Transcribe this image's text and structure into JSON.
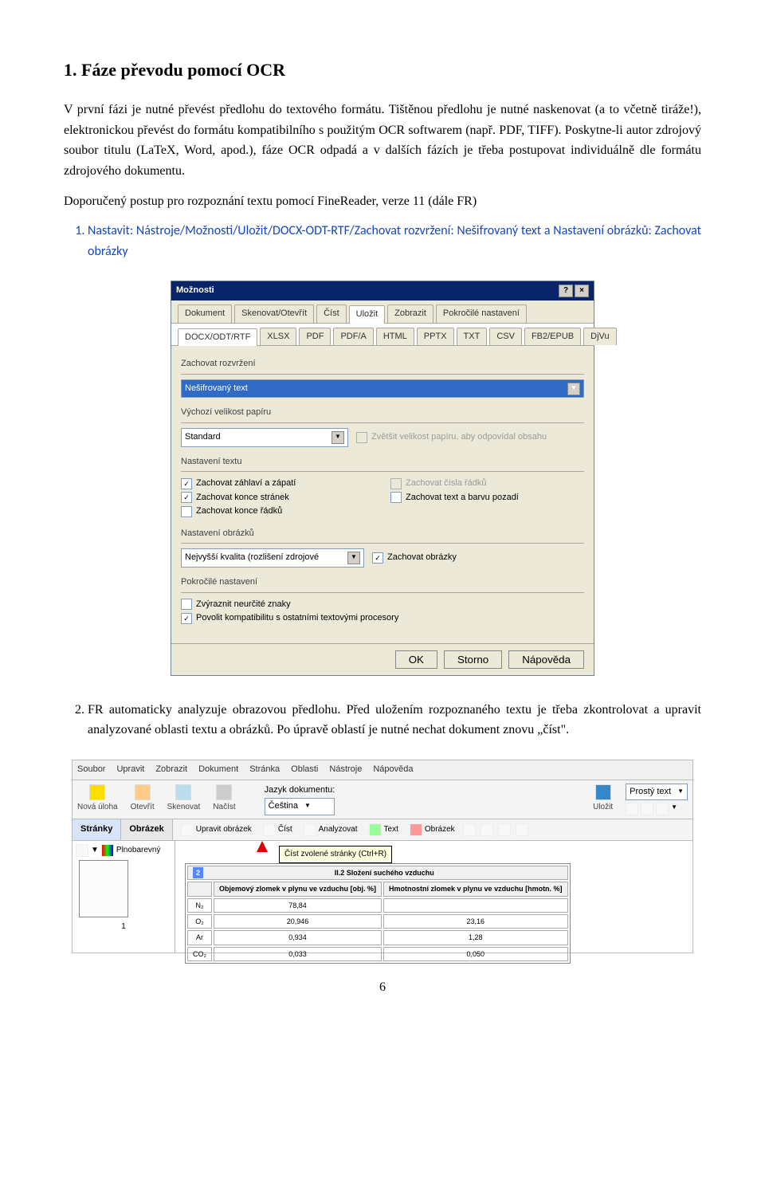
{
  "heading": "1. Fáze převodu pomocí OCR",
  "p1": "V první fázi je nutné převést předlohu do textového formátu. Tištěnou předlohu je nutné naskenovat (a to včetně tiráže!), elektronickou převést do formátu kompatibilního s použitým OCR softwarem (např. PDF, TIFF). Poskytne-li autor zdrojový soubor titulu (LaTeX, Word, apod.), fáze OCR odpadá a v dalších fázích je třeba postupovat individuálně dle formátu zdrojového dokumentu.",
  "p2": "Doporučený postup pro rozpoznání textu pomocí FineReader, verze 11 (dále FR)",
  "li1": "Nastavit: Nástroje/Možnosti/Uložit/DOCX-ODT-RTF/Zachovat rozvržení: Nešifrovaný text a Nastavení obrázků: Zachovat obrázky",
  "li2": "FR automaticky analyzuje obrazovou předlohu. Před uložením rozpoznaného textu je třeba zkontrolovat a upravit analyzované oblasti textu a obrázků. Po úpravě oblastí je nutné nechat dokument znovu „číst\".",
  "dlg": {
    "title": "Možnosti",
    "tabs": [
      "Dokument",
      "Skenovat/Otevřít",
      "Číst",
      "Uložit",
      "Zobrazit",
      "Pokročilé nastavení"
    ],
    "active_tab": 3,
    "fmt_tabs": [
      "DOCX/ODT/RTF",
      "XLSX",
      "PDF",
      "PDF/A",
      "HTML",
      "PPTX",
      "TXT",
      "CSV",
      "FB2/EPUB",
      "DjVu"
    ],
    "g_layout": "Zachovat rozvržení",
    "layout_val": "Nešifrovaný text",
    "g_paper": "Výchozí velikost papíru",
    "paper_val": "Standard",
    "chk_enlarge": "Zvětšit velikost papíru, aby odpovídal obsahu",
    "g_text": "Nastavení textu",
    "chk_header": "Zachovat záhlaví a zápatí",
    "chk_linenum": "Zachovat čísla řádků",
    "chk_pagebreak": "Zachovat konce stránek",
    "chk_bgtext": "Zachovat text a barvu pozadí",
    "chk_linebreak": "Zachovat konce řádků",
    "g_img": "Nastavení obrázků",
    "img_val": "Nejvyšší kvalita (rozlišení zdrojové",
    "chk_keepimg": "Zachovat obrázky",
    "g_adv": "Pokročilé nastavení",
    "chk_hilite": "Zvýraznit neurčité znaky",
    "chk_compat": "Povolit kompatibilitu s ostatními textovými procesory",
    "btn_ok": "OK",
    "btn_cancel": "Storno",
    "btn_help": "Nápověda"
  },
  "tb": {
    "menus": [
      "Soubor",
      "Upravit",
      "Zobrazit",
      "Dokument",
      "Stránka",
      "Oblasti",
      "Nástroje",
      "Nápověda"
    ],
    "btn_new": "Nová úloha",
    "btn_open": "Otevřít",
    "btn_scan": "Skenovat",
    "btn_load": "Načíst",
    "lang_label": "Jazyk dokumentu:",
    "lang_val": "Čeština",
    "btn_save": "Uložit",
    "fmt_val": "Prostý text",
    "tab_pages": "Stránky",
    "tab_image": "Obrázek",
    "color_val": "Plnobarevný",
    "btn_editimg": "Upravit obrázek",
    "btn_read": "Číst",
    "btn_analyze": "Analyzovat",
    "btn_text": "Text",
    "btn_image": "Obrázek",
    "tooltip": "Číst zvolené stránky (Ctrl+R)",
    "tbl_title": "II.2 Složení suchého vzduchu",
    "tbl_h1": "Objemový zlomek v plynu ve vzduchu [obj. %]",
    "tbl_h2": "Hmotnostní zlomek v plynu ve vzduchu [hmotn. %]",
    "rows": [
      {
        "n": "N₂",
        "a": "78,84",
        "b": ""
      },
      {
        "n": "O₂",
        "a": "20,946",
        "b": "23,16"
      },
      {
        "n": "Ar",
        "a": "0,934",
        "b": "1,28"
      },
      {
        "n": "CO₂",
        "a": "0,033",
        "b": "0,050"
      }
    ],
    "page": "1"
  },
  "page_num": "6"
}
